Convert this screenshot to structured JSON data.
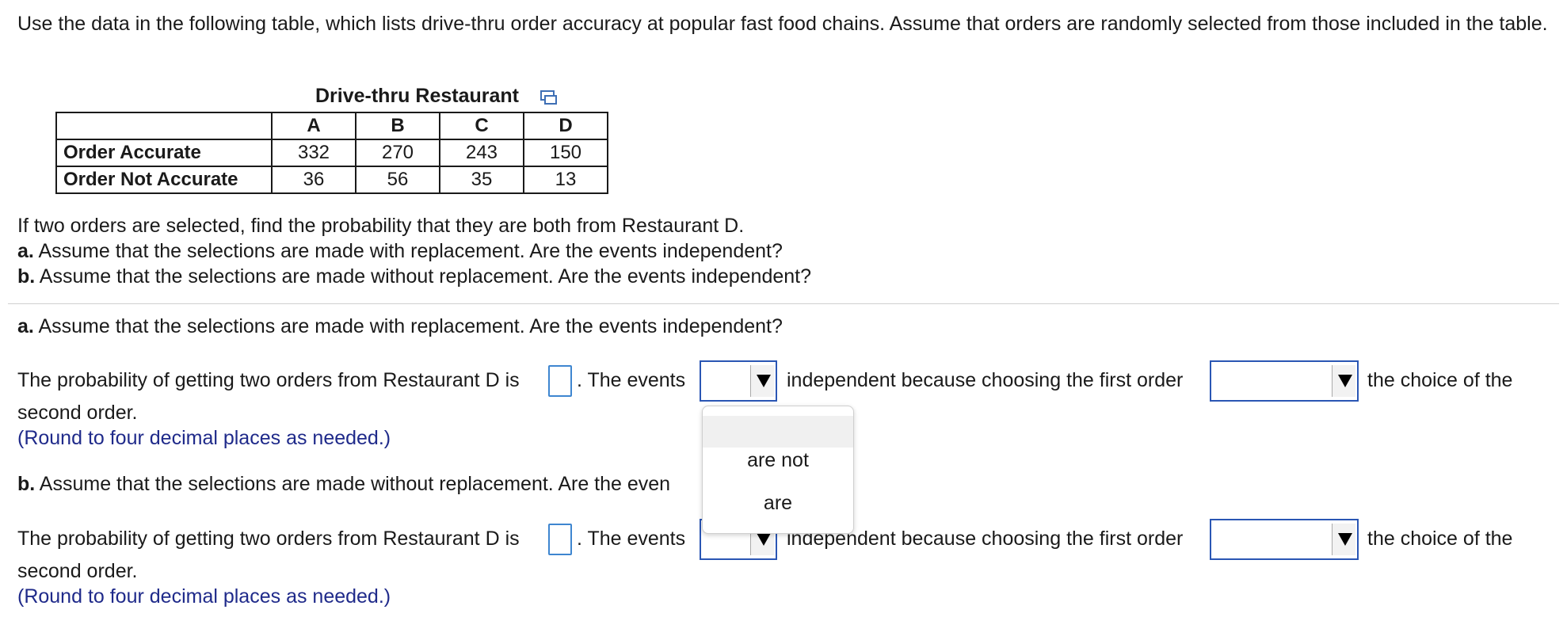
{
  "intro": "Use the data in the following table, which lists drive-thru order accuracy at popular fast food chains. Assume that orders are randomly selected from those included in the table.",
  "table": {
    "caption": "Drive-thru Restaurant",
    "columns": [
      "A",
      "B",
      "C",
      "D"
    ],
    "rows": [
      {
        "label": "Order Accurate",
        "values": [
          "332",
          "270",
          "243",
          "150"
        ]
      },
      {
        "label": "Order Not Accurate",
        "values": [
          "36",
          "56",
          "35",
          "13"
        ]
      }
    ]
  },
  "question": {
    "main": "If two orders are selected, find the probability that they are both from Restaurant D.",
    "a_label": "a.",
    "a_text": "Assume that the selections are made with replacement. Are the events independent?",
    "b_label": "b.",
    "b_text": "Assume that the selections are made without replacement. Are the events independent?"
  },
  "part_a": {
    "label": "a.",
    "heading": "Assume that the selections are made with replacement. Are the events independent?",
    "prob_text": "The probability of getting two orders from Restaurant D is",
    "events_text": ". The events",
    "indep_text": "independent because choosing the first order",
    "choice_text": "the choice of the",
    "second_order": "second order.",
    "round_note": "(Round to four decimal places as needed.)"
  },
  "part_b": {
    "label": "b.",
    "heading": "Assume that the selections are made without replacement. Are the even",
    "prob_text": "The probability of getting two orders from Restaurant D is",
    "events_text": ". The events",
    "indep_text": "independent because choosing the first order",
    "choice_text": "the choice of the",
    "second_order": "second order.",
    "round_note": "(Round to four decimal places as needed.)"
  },
  "dropdown": {
    "options": [
      "",
      "are not",
      "are"
    ]
  }
}
